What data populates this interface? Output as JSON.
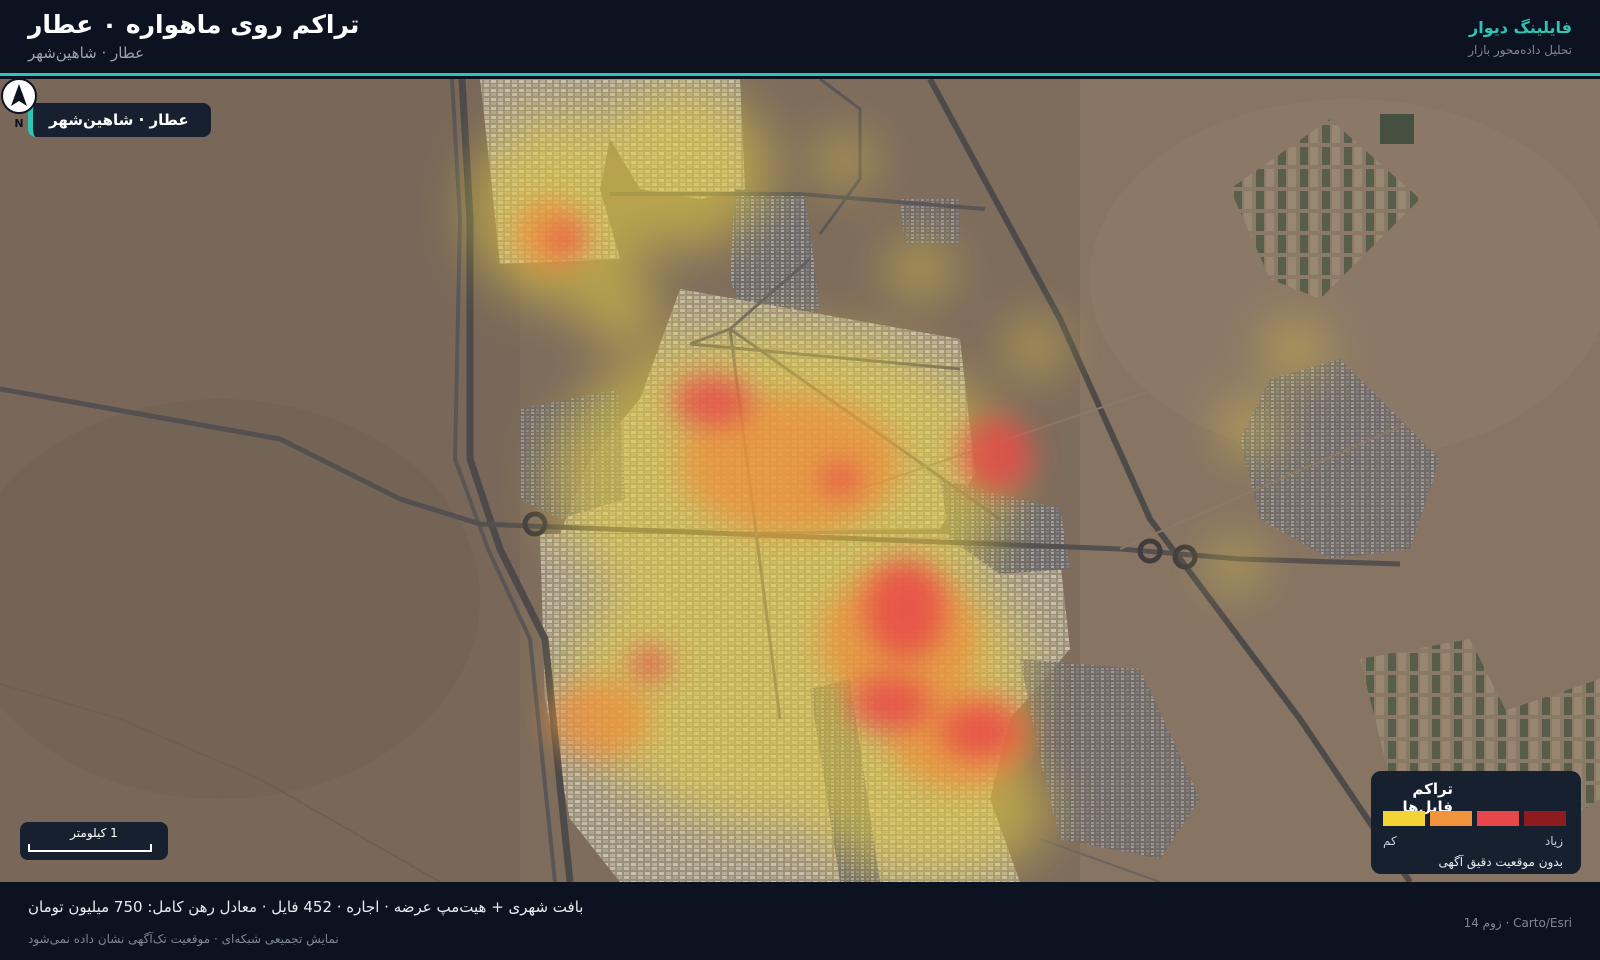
{
  "header": {
    "title": "تراکم روی ماهواره ۰ عطار",
    "subtitle": "عطار · شاهین‌شهر",
    "brand": "فایلینگ دیوار",
    "brand_tagline": "تحلیل داده‌محور بازار"
  },
  "map": {
    "location_chip": "عطار · شاهین‌شهر",
    "compass_label": "N",
    "scale_label": "1 کیلومتر",
    "attribution": "Carto/Esri · زوم 14"
  },
  "legend": {
    "title": "تراکم فایل‌ها",
    "low_label": "کم",
    "high_label": "زیاد",
    "note": "بدون موقعیت دقیق آگهی",
    "colors": [
      "#f2d535",
      "#f0933a",
      "#e8474a",
      "#8e1c1f"
    ]
  },
  "footer": {
    "stats": "بافت شهری + هیت‌مپ عرضه · اجاره · 452 فایل · معادل رهن کامل: 750 میلیون تومان",
    "notes": "نمایش تجمیعی شبکه‌ای · موقعیت تک‌آگهی نشان داده نمی‌شود"
  },
  "colors": {
    "accent": "#2ec4b6",
    "background": "#0c1220",
    "panel": "#16202f"
  }
}
